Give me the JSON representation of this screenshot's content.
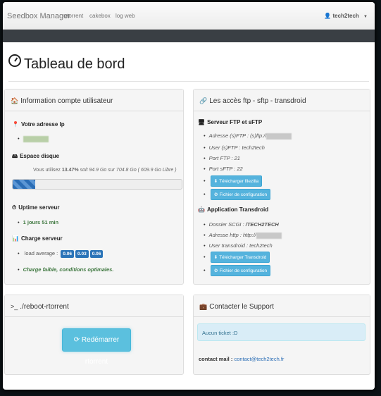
{
  "navbar": {
    "brand": "Seedbox Manager",
    "links": [
      "rutorrent",
      "cakebox",
      "log web"
    ],
    "user": "tech2tech"
  },
  "page_title": "Tableau de bord",
  "account_panel": {
    "title": "Information compte utilisateur",
    "ip_label": "Votre adresse Ip",
    "disk_label": "Espace disque",
    "disk_text_prefix": "Vous utilisez",
    "disk_percent": "13.47%",
    "disk_text_suffix": "soit 94.9 Go sur 704.8 Go ( 609.9 Go Libre )",
    "disk_fraction": 0.1347,
    "uptime_label": "Uptime serveur",
    "uptime_value": "1 jours 51 min",
    "load_label": "Charge serveur",
    "load_text": "load average :",
    "load_values": [
      "0.06",
      "0.03",
      "0.06"
    ],
    "load_status": "Charge faible, conditions optimales."
  },
  "access_panel": {
    "title": "Les accès ftp - sftp - transdroid",
    "ftp_header": "Serveur FTP et sFTP",
    "ftp_address": "Adresse (s)FTP : (s)ftp://",
    "ftp_user": "User (s)FTP : tech2tech",
    "ftp_port": "Port FTP : 21",
    "sftp_port": "Port sFTP : 22",
    "btn_filezilla": "Télécharger filezilla",
    "btn_config1": "Fichier de configuration",
    "transdroid_header": "Application Transdroid",
    "scgi_label": "Dossier SCGI :",
    "scgi_value": "/TECH2TECH",
    "http_address": "Adresse http : http://",
    "transdroid_user": "User transdroid : tech2tech",
    "btn_transdroid": "Télécharger Transdroid",
    "btn_config2": "Fichier de configuration"
  },
  "reboot_panel": {
    "title": "./reboot-rtorrent",
    "prompt": ">_",
    "button": "Redémarrer rtorrent"
  },
  "support_panel": {
    "title": "Contacter le Support",
    "alert": "Aucun ticket :D",
    "contact_label": "contact mail :",
    "contact_email": "contact@tech2tech.fr"
  }
}
